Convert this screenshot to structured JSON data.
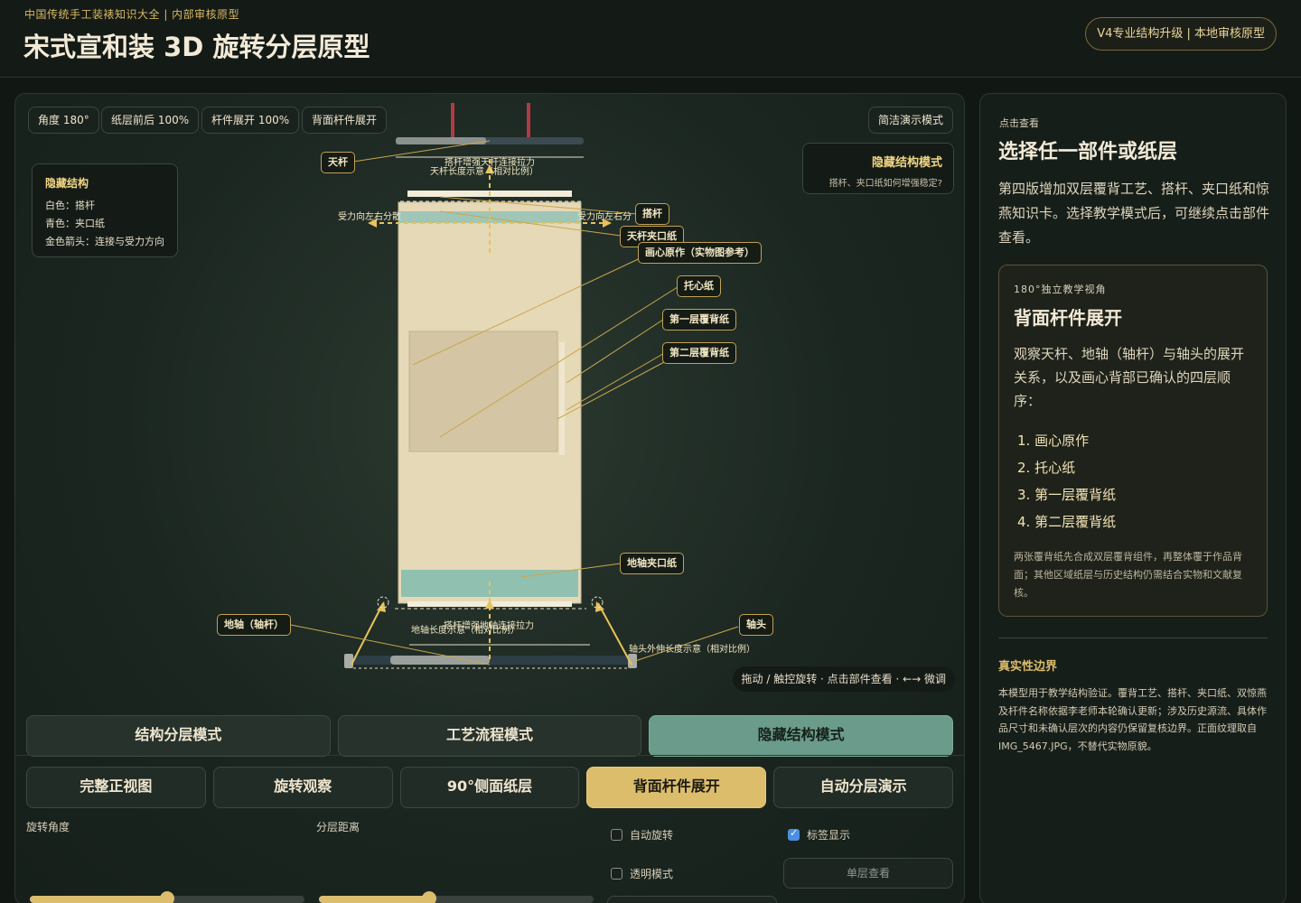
{
  "header": {
    "kicker": "中国传统手工装裱知识大全 | 内部审核原型",
    "title": "宋式宣和装 3D 旋转分层原型",
    "badge": "V4专业结构升级 | 本地审核原型"
  },
  "stage": {
    "chips": [
      "角度 180°",
      "纸层前后 100%",
      "杆件展开 100%",
      "背面杆件展开"
    ],
    "clean_mode": "简洁演示模式",
    "legend": {
      "title": "隐藏结构",
      "items": [
        "白色：搭杆",
        "青色：夹口纸",
        "金色箭头：连接与受力方向"
      ]
    },
    "callout": {
      "title": "隐藏结构模式",
      "subtitle": "搭杆、夹口纸如何增强稳定?"
    },
    "hint": "拖动 / 触控旋转 · 点击部件查看 · ←→ 微调",
    "labels": {
      "tiangan": "天杆",
      "dagan": "搭杆",
      "tiangan_jiakou": "天杆夹口纸",
      "huaxin": "画心原作（实物图参考）",
      "tuoxin": "托心纸",
      "fubei1": "第一层覆背纸",
      "fubei2": "第二层覆背纸",
      "dizhou_jiakou": "地轴夹口纸",
      "dizhou": "地轴（轴杆）",
      "zhoutou": "轴头"
    },
    "annotations": {
      "top_pull": "搭杆增强天杆连接拉力",
      "top_length": "天杆长度示意（相对比例）",
      "force_left": "受力向左右分散",
      "force_right": "受力向左右分",
      "bottom_pull": "搭杆增强地轴连接拉力",
      "bottom_length": "地轴长度示意（相对比例）",
      "axis_head": "轴头外伸长度示意（相对比例）"
    }
  },
  "modes": [
    {
      "label": "结构分层模式",
      "active": false
    },
    {
      "label": "工艺流程模式",
      "active": false
    },
    {
      "label": "隐藏结构模式",
      "active": true
    }
  ],
  "views": [
    {
      "label": "完整正视图",
      "active": false
    },
    {
      "label": "旋转观察",
      "active": false
    },
    {
      "label": "90°侧面纸层",
      "active": false
    },
    {
      "label": "背面杆件展开",
      "active": true
    },
    {
      "label": "自动分层演示",
      "active": false
    }
  ],
  "controls": {
    "rotation_label": "旋转角度",
    "rotation_value": 0.5,
    "layer_label": "分层距离",
    "layer_value": 0.4,
    "auto_rotate": {
      "label": "自动旋转",
      "checked": false
    },
    "show_labels": {
      "label": "标签显示",
      "checked": true
    },
    "transparent": {
      "label": "透明模式",
      "checked": false
    },
    "single_layer": "单层查看"
  },
  "panel": {
    "kicker": "点击查看",
    "title": "选择任一部件或纸层",
    "desc": "第四版增加双层覆背工艺、搭杆、夹口纸和惊燕知识卡。选择教学模式后，可继续点击部件查看。",
    "card": {
      "kicker": "180°独立教学视角",
      "title": "背面杆件展开",
      "desc": "观察天杆、地轴（轴杆）与轴头的展开关系，以及画心背部已确认的四层顺序：",
      "list": [
        "1. 画心原作",
        "2. 托心纸",
        "3. 第一层覆背纸",
        "4. 第二层覆背纸"
      ],
      "note": "两张覆背纸先合成双层覆背组件，再整体覆于作品背面；其他区域纸层与历史结构仍需结合实物和文献复核。"
    },
    "boundary_title": "真实性边界",
    "boundary_text": "本模型用于教学结构验证。覆背工艺、搭杆、夹口纸、双惊燕及杆件名称依据李老师本轮确认更新；涉及历史源流、具体作品尺寸和未确认层次的内容仍保留复核边界。正面纹理取自IMG_5467.JPG，不替代实物原貌。"
  },
  "colors": {
    "accent_gold": "#dcbd6c",
    "accent_teal": "#6b9b8a",
    "background": "#111813"
  }
}
